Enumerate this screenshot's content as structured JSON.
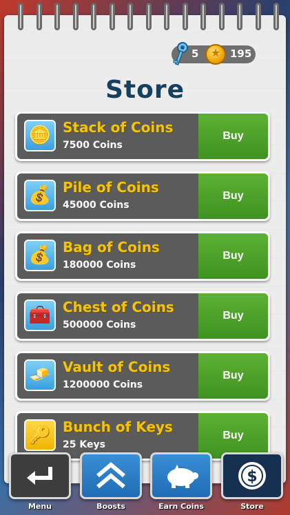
{
  "header": {
    "keys_count": "5",
    "coins_count": "195",
    "title": "Store"
  },
  "items": [
    {
      "name": "Stack of Coins",
      "amount": "7500 Coins",
      "buy_label": "Buy",
      "icon": "coin-stack-icon"
    },
    {
      "name": "Pile of Coins",
      "amount": "45000 Coins",
      "buy_label": "Buy",
      "icon": "coin-pile-icon"
    },
    {
      "name": "Bag of Coins",
      "amount": "180000 Coins",
      "buy_label": "Buy",
      "icon": "coin-bag-icon"
    },
    {
      "name": "Chest of Coins",
      "amount": "500000 Coins",
      "buy_label": "Buy",
      "icon": "treasure-chest-icon"
    },
    {
      "name": "Vault of Coins",
      "amount": "1200000 Coins",
      "buy_label": "Buy",
      "icon": "gold-bars-icon"
    },
    {
      "name": "Bunch of Keys",
      "amount": "25 Keys",
      "buy_label": "Buy",
      "icon": "keys-icon"
    }
  ],
  "nav": {
    "menu": "Menu",
    "boosts": "Boosts",
    "earn_coins": "Earn Coins",
    "store": "Store"
  },
  "colors": {
    "title": "#16405f",
    "item_name": "#f5c400",
    "buy": "#4aa12a",
    "active_tab": "#16304f"
  }
}
